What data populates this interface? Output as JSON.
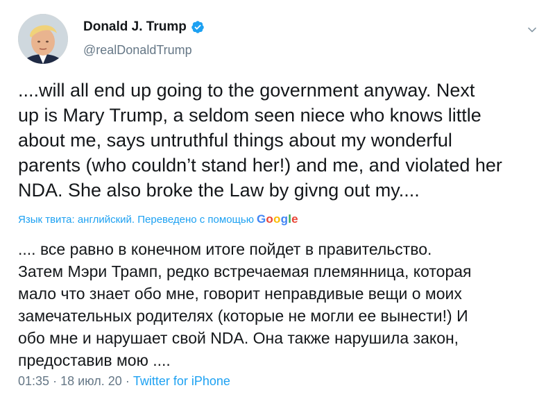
{
  "user": {
    "display_name": "Donald J. Trump",
    "handle": "@realDonaldTrump",
    "verified": true
  },
  "icons": {
    "avatar": "profile-photo",
    "verified": "verified-badge-icon",
    "menu": "chevron-down-icon"
  },
  "tweet": {
    "text": "....will all end up going to the government anyway. Next\nup is Mary Trump, a seldom seen niece who knows little\nabout me, says untruthful things about my wonderful\nparents (who couldn’t stand her!) and me, and violated her\nNDA. She also broke the Law by givng out my....",
    "translation_note": "Язык твита: английский. Переведено с помощью",
    "translation_provider": "Google",
    "translation": ".... все равно в конечном итоге пойдет в правительство.\nЗатем Мэри Трамп, редко встречаемая племянница, которая\nмало что знает обо мне, говорит неправдивые вещи о моих\nзамечательных родителях (которые не могли ее вынести!) И\nобо мне и нарушает свой NDA. Она также нарушила закон,\nпредоставив мою ....",
    "time": "01:35",
    "separator": "·",
    "date": "18 июл. 20",
    "source": "Twitter for iPhone"
  },
  "colors": {
    "link_blue": "#1da1f2",
    "secondary_gray": "#657786",
    "text": "#14171a",
    "google_blue": "#4285f4",
    "google_red": "#ea4335",
    "google_yellow": "#fbbc05",
    "google_green": "#34a853"
  }
}
